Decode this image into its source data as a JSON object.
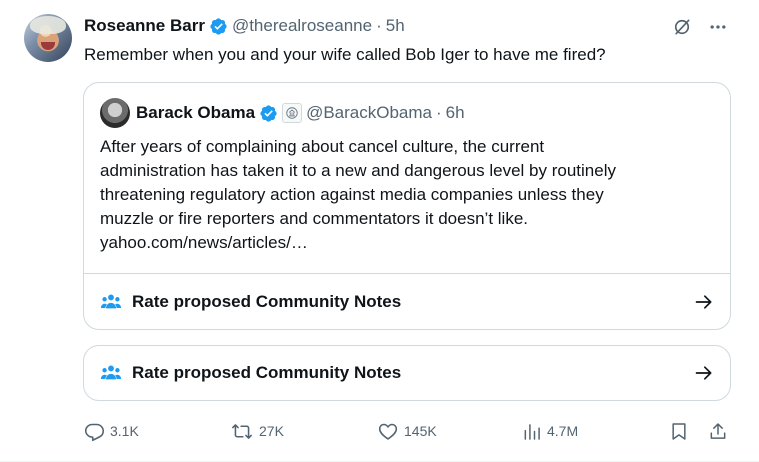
{
  "tweet": {
    "author_name": "Roseanne Barr",
    "author_handle": "@therealroseanne",
    "separator": "·",
    "time": "5h",
    "text": "Remember when you and your wife called Bob Iger to have me fired?"
  },
  "quoted": {
    "author_name": "Barack Obama",
    "author_handle": "@BarackObama",
    "separator": "·",
    "time": "6h",
    "lines": [
      "After years of complaining about cancel culture, the current",
      "administration has taken it to a new and dangerous level by routinely",
      "threatening regulatory action against media companies unless they",
      "muzzle or fire reporters and commentators it doesn’t like.",
      "yahoo.com/news/articles/…"
    ],
    "notes_label": "Rate proposed Community Notes"
  },
  "notes_card": {
    "label": "Rate proposed Community Notes"
  },
  "actions": {
    "replies": "3.1K",
    "retweets": "27K",
    "likes": "145K",
    "views": "4.7M"
  },
  "icons": {
    "verified": "verified-badge-icon",
    "government": "government-seal-icon",
    "grok": "grok-icon",
    "more": "more-icon",
    "people": "people-icon",
    "arrow": "arrow-right-icon",
    "reply": "reply-icon",
    "retweet": "retweet-icon",
    "like": "heart-icon",
    "views": "views-icon",
    "bookmark": "bookmark-icon",
    "share": "share-icon"
  },
  "colors": {
    "verified_blue": "#1d9bf0",
    "text_primary": "#0f1419",
    "text_secondary": "#536471",
    "border": "#cfd9de",
    "people_icon_blue": "#1d9bf0"
  }
}
